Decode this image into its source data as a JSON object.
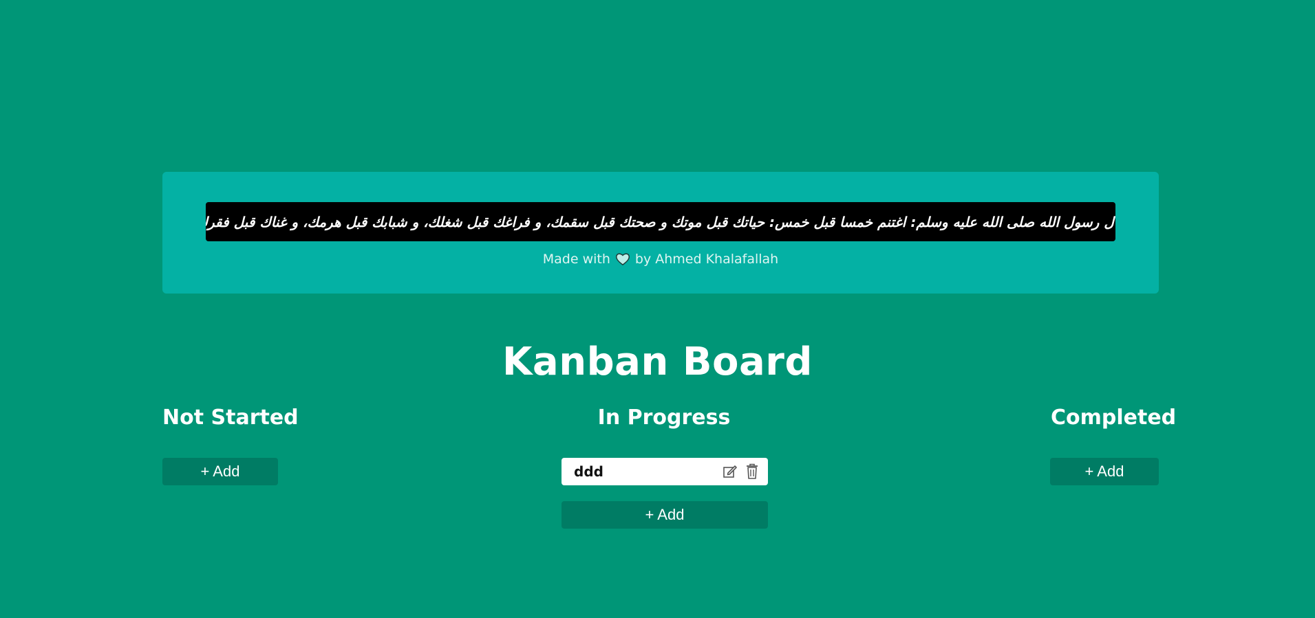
{
  "banner": {
    "quote": "قال رسول الله صلى الله عليه وسلم: اغتنم خمسا قبل خمس: حياتك قبل موتك و صحتك قبل سقمك، و فراغك قبل شغلك، و شبابك قبل هرمك، و غناك قبل فقرك",
    "credit_prefix": "Made with",
    "credit_icon": "heart-icon",
    "credit_suffix": "by Ahmed Khalafallah"
  },
  "board": {
    "title": "Kanban Board",
    "columns": [
      {
        "title": "Not Started",
        "cards": [],
        "add_label": "+ Add"
      },
      {
        "title": "In Progress",
        "cards": [
          {
            "text": "ddd",
            "edit_icon": "edit-icon",
            "delete_icon": "trash-icon"
          }
        ],
        "add_label": "+ Add"
      },
      {
        "title": "Completed",
        "cards": [],
        "add_label": "+ Add"
      }
    ]
  },
  "colors": {
    "background": "#009677",
    "banner": "#04b1a4",
    "quote_bg": "#000000",
    "button": "#007c64",
    "card": "#ffffff"
  }
}
